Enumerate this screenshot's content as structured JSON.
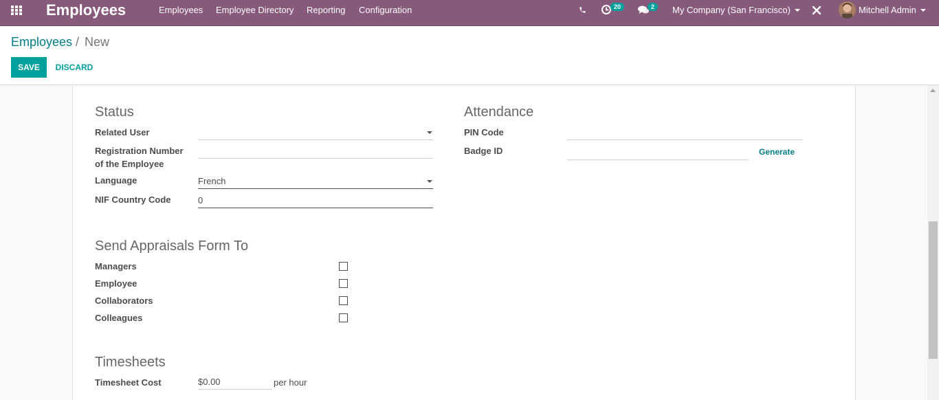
{
  "nav": {
    "brand": "Employees",
    "menu": [
      "Employees",
      "Employee Directory",
      "Reporting",
      "Configuration"
    ],
    "activity_badge": "20",
    "messages_badge": "2",
    "company": "My Company (San Francisco)",
    "user": "Mitchell Admin",
    "icons": [
      "apps-grid-icon",
      "phone-icon",
      "activity-clock-icon",
      "chat-icon",
      "debug-tools-icon"
    ]
  },
  "breadcrumb": {
    "parent": "Employees",
    "separator": "/",
    "current": "New"
  },
  "buttons": {
    "save": "SAVE",
    "discard": "DISCARD"
  },
  "status": {
    "title": "Status",
    "related_user_label": "Related User",
    "related_user_value": "",
    "registration_label_line1": "Registration Number",
    "registration_label_line2": "of the Employee",
    "registration_value": "",
    "language_label": "Language",
    "language_value": "French",
    "nif_label": "NIF Country Code",
    "nif_value": "0"
  },
  "attendance": {
    "title": "Attendance",
    "pin_label": "PIN Code",
    "pin_value": "",
    "badge_label": "Badge ID",
    "badge_value": "",
    "generate_label": "Generate"
  },
  "appraisals": {
    "title": "Send Appraisals Form To",
    "options": [
      {
        "label": "Managers",
        "checked": false
      },
      {
        "label": "Employee",
        "checked": false
      },
      {
        "label": "Collaborators",
        "checked": false
      },
      {
        "label": "Colleagues",
        "checked": false
      }
    ]
  },
  "timesheets": {
    "title": "Timesheets",
    "cost_label": "Timesheet Cost",
    "cost_value": "$0.00",
    "cost_suffix": "per hour"
  },
  "colors": {
    "navbar": "#875a7b",
    "primary": "#00a09d",
    "link": "#017e84"
  }
}
